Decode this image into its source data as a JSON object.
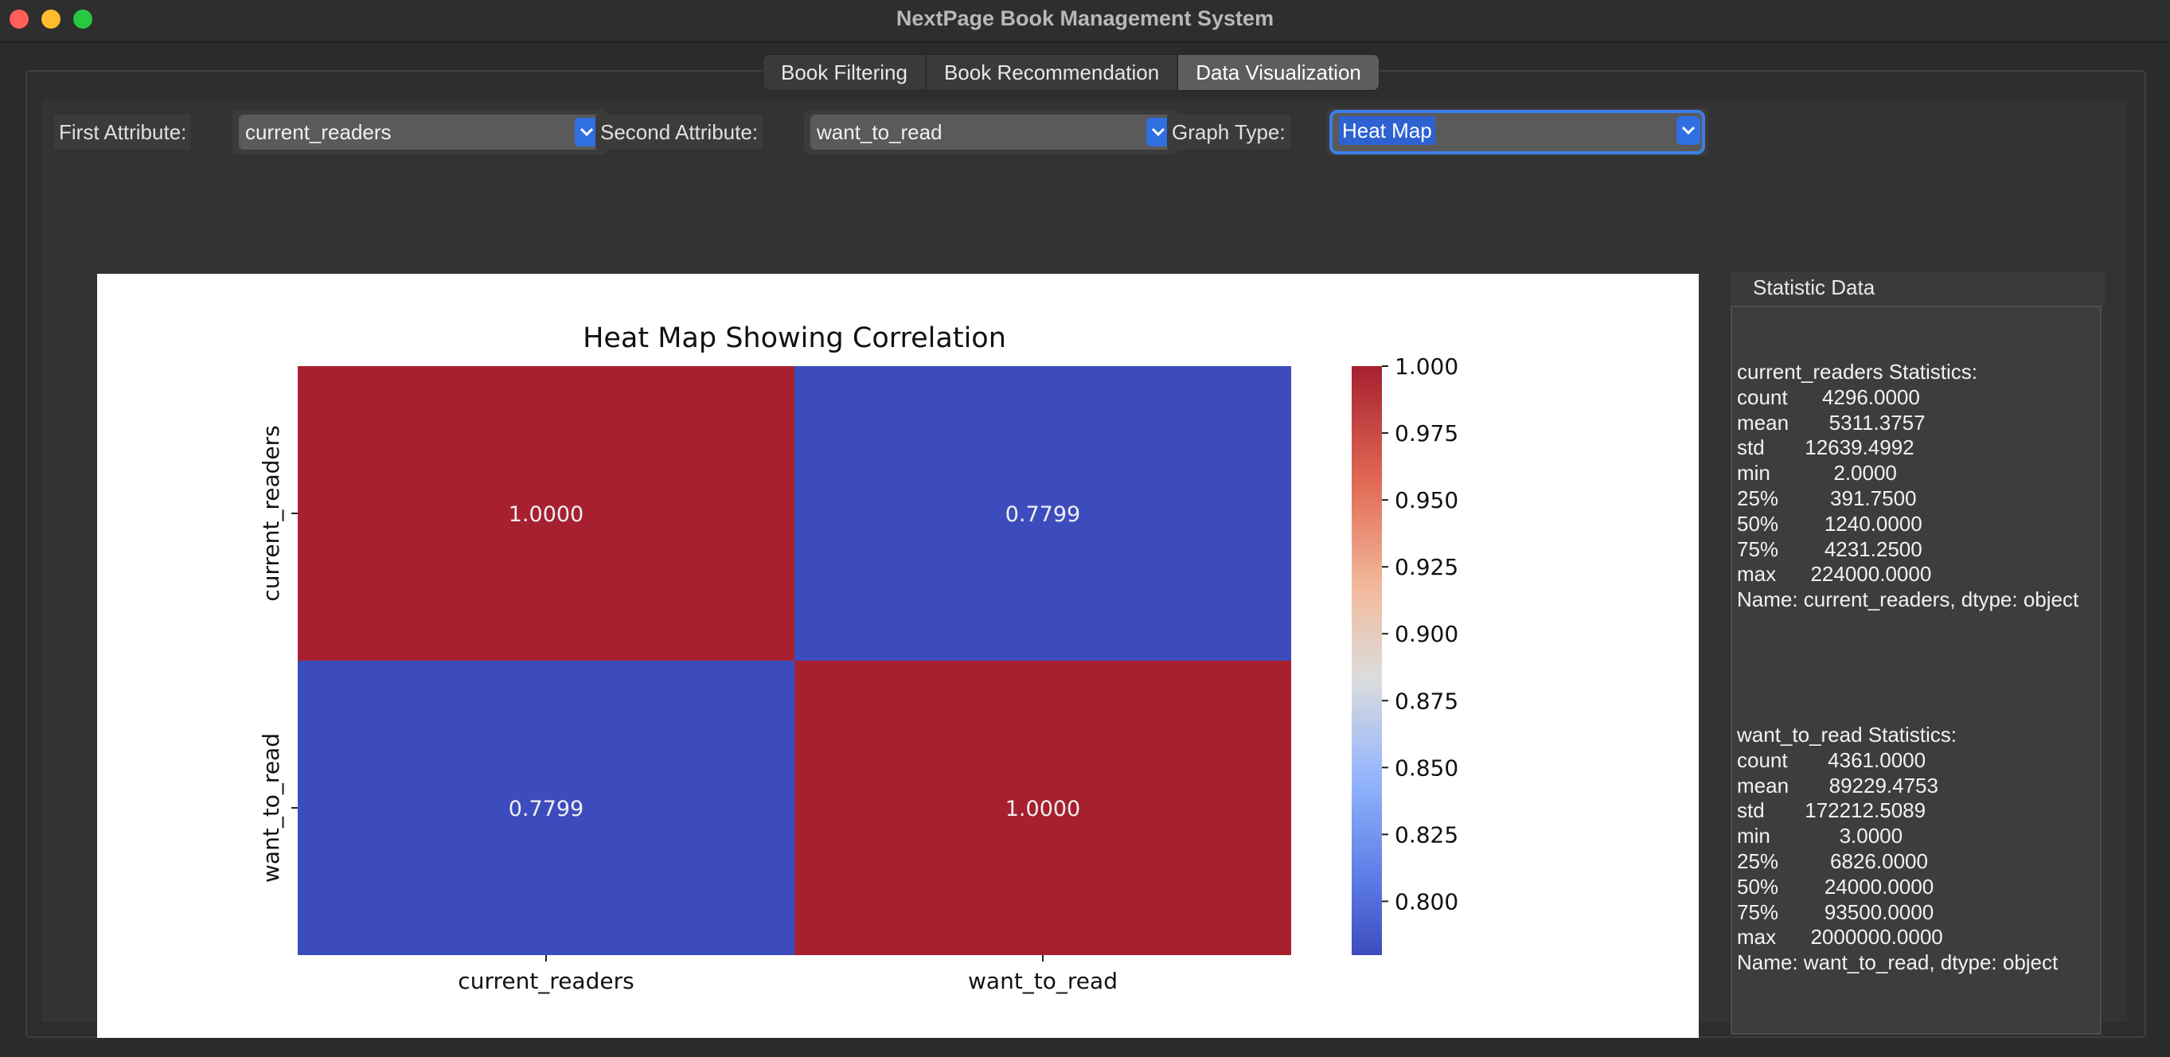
{
  "window": {
    "title": "NextPage Book Management System"
  },
  "tabs": [
    {
      "label": "Book Filtering"
    },
    {
      "label": "Book Recommendation"
    },
    {
      "label": "Data Visualization",
      "active": true
    }
  ],
  "controls": {
    "first_attr_label": "First Attribute:",
    "first_attr_value": "current_readers",
    "second_attr_label": "Second Attribute:",
    "second_attr_value": "want_to_read",
    "graph_type_label": "Graph Type:",
    "graph_type_value": "Heat Map"
  },
  "chart_data": {
    "type": "heatmap",
    "title": "Heat Map Showing Correlation",
    "rows": [
      "current_readers",
      "want_to_read"
    ],
    "cols": [
      "current_readers",
      "want_to_read"
    ],
    "values": [
      [
        1.0,
        0.7799
      ],
      [
        0.7799,
        1.0
      ]
    ],
    "cell_labels": [
      [
        "1.0000",
        "0.7799"
      ],
      [
        "0.7799",
        "1.0000"
      ]
    ],
    "colormap": "coolwarm",
    "colorbar": {
      "range": [
        0.7799,
        1.0
      ],
      "ticks": [
        1.0,
        0.975,
        0.95,
        0.925,
        0.9,
        0.875,
        0.85,
        0.825,
        0.8
      ],
      "tick_labels": [
        "1.000",
        "0.975",
        "0.950",
        "0.925",
        "0.900",
        "0.875",
        "0.850",
        "0.825",
        "0.800"
      ]
    },
    "colors": {
      "high": "#a62030",
      "low": "#3d4cbd"
    }
  },
  "stats": {
    "title": "Statistic Data",
    "block1": "current_readers Statistics:\ncount      4296.0000\nmean       5311.3757\nstd       12639.4992\nmin           2.0000\n25%         391.7500\n50%        1240.0000\n75%        4231.2500\nmax      224000.0000\nName: current_readers, dtype: object",
    "block2": "want_to_read Statistics:\ncount       4361.0000\nmean       89229.4753\nstd       172212.5089\nmin            3.0000\n25%         6826.0000\n50%        24000.0000\n75%        93500.0000\nmax      2000000.0000\nName: want_to_read, dtype: object"
  }
}
